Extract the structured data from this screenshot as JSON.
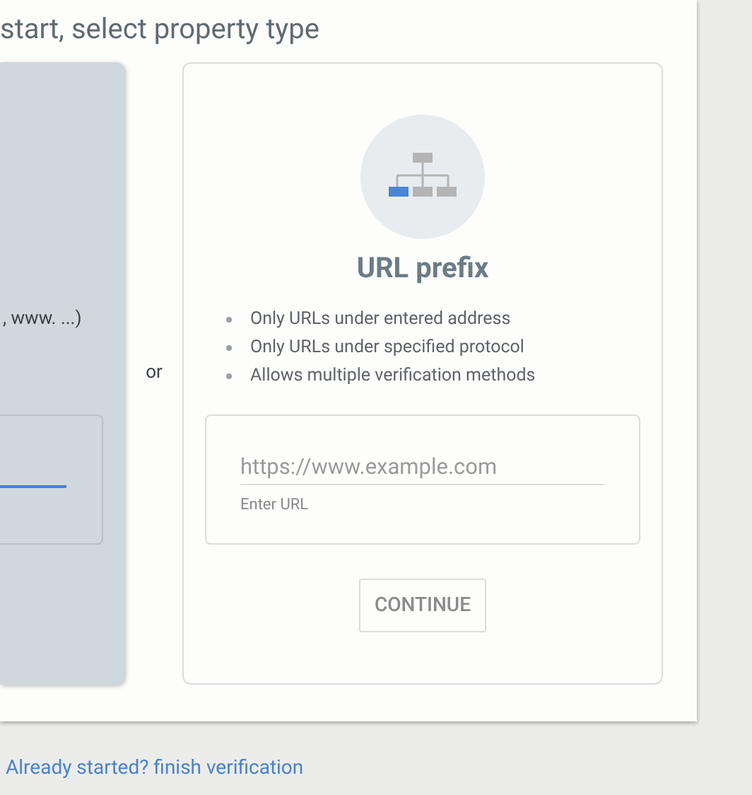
{
  "heading": "start, select property type",
  "domain_card": {
    "text": ", www. ...)",
    "field": {
      "focused": true
    }
  },
  "separator": "or",
  "url_prefix_card": {
    "title": "URL prefix",
    "bullets": [
      "Only URLs under entered address",
      "Only URLs under specified protocol",
      "Allows multiple verification methods"
    ],
    "field": {
      "placeholder": "https://www.example.com",
      "helper": "Enter URL"
    },
    "button": {
      "label": "CONTINUE",
      "disabled": true
    }
  },
  "link": "Already started? finish verification"
}
